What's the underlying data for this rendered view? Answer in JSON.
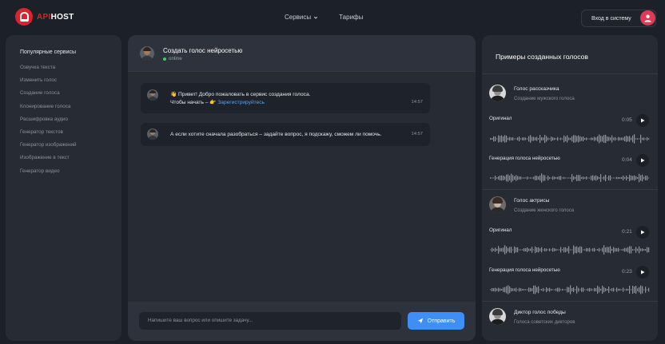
{
  "header": {
    "logo": {
      "api": "API",
      "host": "HOST"
    },
    "nav": [
      {
        "label": "Сервисы",
        "has_dropdown": true
      },
      {
        "label": "Тарифы",
        "has_dropdown": false
      }
    ],
    "login_label": "Вход в систему",
    "avatar_icon": "user-icon",
    "accent": "#e03a56"
  },
  "sidebar": {
    "title": "Популярные сервисы",
    "items": [
      {
        "label": "Озвучка текста"
      },
      {
        "label": "Изменить голос"
      },
      {
        "label": "Создание голоса"
      },
      {
        "label": "Клонирование голоса"
      },
      {
        "label": "Расшифровка аудио"
      },
      {
        "label": "Генератор текстов"
      },
      {
        "label": "Генератор изображений"
      },
      {
        "label": "Изображение в текст"
      },
      {
        "label": "Генератор видео"
      }
    ]
  },
  "chat": {
    "title": "Создать голос нейросетью",
    "status": "online",
    "messages": [
      {
        "line1": "👋 Привет! Добро пожаловать в сервис создания голоса.",
        "line2_prefix": "Чтобы начать – 👉 ",
        "link": "Зарегистрируйтесь",
        "time": "14:57"
      },
      {
        "line1": "А если хотите сначала разобраться – задайте вопрос, я подскажу, сможем ли помочь.",
        "time": "14:57"
      }
    ],
    "input_placeholder": "Напишите ваш вопрос или опишите задачу...",
    "send_label": "Отправить",
    "send_color": "#3f8ef5"
  },
  "examples": {
    "title": "Примеры созданных голосов",
    "voices": [
      {
        "name": "Голос рассказчика",
        "subtitle": "Создание мужского голоса",
        "tracks": [
          {
            "label": "Оригинал",
            "time": "0:05"
          },
          {
            "label": "Генерация голоса нейросетью",
            "time": "0:04"
          }
        ]
      },
      {
        "name": "Голос актрисы",
        "subtitle": "Создание женского голоса",
        "tracks": [
          {
            "label": "Оригинал",
            "time": "0:21"
          },
          {
            "label": "Генерация голоса нейросетью",
            "time": "0:23"
          }
        ]
      },
      {
        "name": "Диктор голос победы",
        "subtitle": "Голоса советских дикторов",
        "tracks": []
      }
    ]
  }
}
